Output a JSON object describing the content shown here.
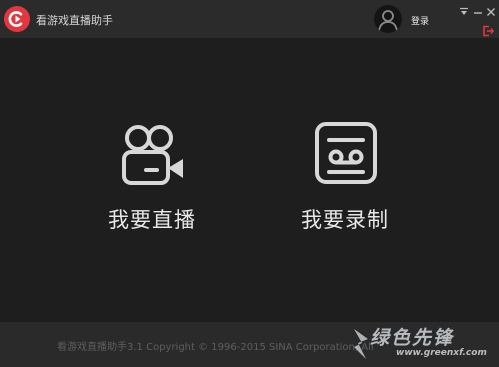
{
  "app": {
    "title": "看游戏直播助手",
    "brand_color": "#e0383e"
  },
  "header": {
    "login_label": "登录",
    "icons": [
      "logo-icon",
      "avatar-icon",
      "dropdown-arrow-icon",
      "minimize-icon",
      "close-icon",
      "logout-icon"
    ]
  },
  "main": {
    "actions": [
      {
        "label": "我要直播",
        "icon": "video-camera-icon"
      },
      {
        "label": "我要录制",
        "icon": "cassette-tape-icon"
      }
    ]
  },
  "footer": {
    "copyright": "看游戏直播助手3.1 Copyright © 1996-2015 SINA Corporation, All"
  },
  "watermark": {
    "text": "绿色先锋",
    "url": "www.greenxf.com"
  }
}
